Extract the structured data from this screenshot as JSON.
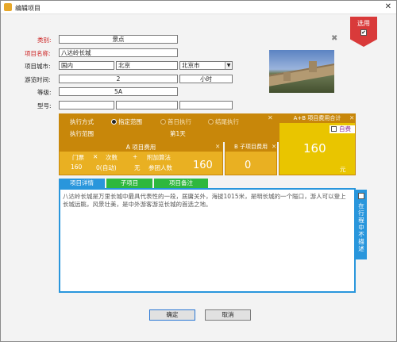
{
  "window": {
    "title": "编辑项目",
    "close": "✕"
  },
  "badge": {
    "label": "选用",
    "checked": "✔"
  },
  "delete_icon": "✖",
  "form": {
    "category_label": "类别:",
    "category_value": "景点",
    "name_label": "项目名称:",
    "name_value": "八达岭长城",
    "city_label": "项目城市:",
    "city_country": "国内",
    "city_province": "北京",
    "city_city": "北京市",
    "duration_label": "游览时间:",
    "duration_value": "2",
    "duration_unit": "小时",
    "grade_label": "等级:",
    "grade_value": "5A",
    "model_label": "型号:"
  },
  "execution": {
    "mode_label": "执行方式",
    "opt_fixed": "指定范围",
    "opt_first": "首日执行",
    "opt_last": "结尾执行",
    "range_label": "执行范围",
    "range_value": "第1天",
    "close": "✕"
  },
  "cost_a": {
    "header": "A 项目费用",
    "col_ticket": "门票",
    "op_times": "✕",
    "col_count": "次数",
    "op_plus": "+",
    "col_extra": "附加算法",
    "ticket": "160",
    "count": "0(自动)",
    "extra": "无",
    "people": "参团人数",
    "total": "160",
    "close": "✕"
  },
  "cost_b": {
    "header": "B 子项目费用",
    "total": "0",
    "close": "✕"
  },
  "cost_ab": {
    "header": "A+B 项目费用合计",
    "self_pay": "自费",
    "total": "160",
    "unit": "元",
    "close": "✕"
  },
  "tabs": [
    "项目详情",
    "子项目",
    "项目备注"
  ],
  "detail_text": "八达岭长城是万里长城中最具代表性的一段，居庸关外，海拔1015米，是明长城的一个隘口，游人可以登上长城远眺，风景壮美，是中外游客游览长城的首选之地。",
  "side_option": "在行程中不描述",
  "buttons": {
    "ok": "确定",
    "cancel": "取消"
  },
  "colors": {
    "exec_bg": "#c8870a",
    "panel_bg": "#e9b022",
    "total_bg": "#e9c500",
    "tab_blue": "#2996dc",
    "tab_green": "#2eb83e",
    "badge_red": "#d93a3a"
  }
}
